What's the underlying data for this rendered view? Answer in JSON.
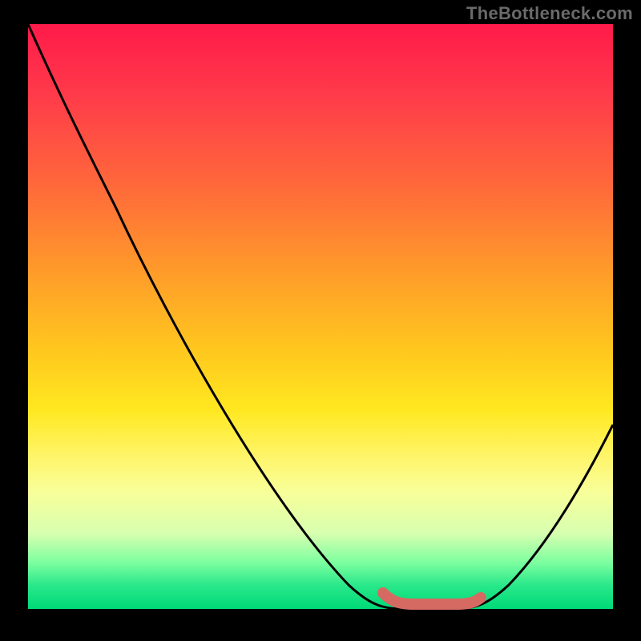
{
  "watermark": "TheBottleneck.com",
  "colors": {
    "gradient_top": "#ff1a4a",
    "gradient_bottom": "#00d978",
    "curve": "#000000",
    "marker": "#d56a63",
    "frame": "#000000",
    "watermark": "#6a6a6a"
  },
  "chart_data": {
    "type": "line",
    "title": "",
    "xlabel": "",
    "ylabel": "",
    "xlim": [
      0,
      100
    ],
    "ylim": [
      0,
      100
    ],
    "series": [
      {
        "name": "bottleneck-curve",
        "x": [
          0,
          5,
          10,
          15,
          20,
          25,
          30,
          35,
          40,
          45,
          50,
          55,
          58,
          62,
          66,
          70,
          74,
          78,
          82,
          86,
          90,
          94,
          98,
          100
        ],
        "values": [
          100,
          92,
          84,
          76,
          67,
          58,
          49,
          40,
          31,
          23,
          15,
          8,
          4,
          1,
          0,
          0,
          0,
          2,
          5,
          10,
          16,
          23,
          30,
          33
        ]
      }
    ],
    "annotations": [
      {
        "name": "optimal-range-marker",
        "x_start": 61,
        "x_end": 77,
        "y": 0,
        "color": "#d56a63"
      }
    ],
    "background": {
      "type": "vertical-gradient",
      "stops": [
        {
          "pos": 0.0,
          "color": "#ff1a4a"
        },
        {
          "pos": 0.28,
          "color": "#ff6a3a"
        },
        {
          "pos": 0.56,
          "color": "#ffc81e"
        },
        {
          "pos": 0.8,
          "color": "#f8ff9a"
        },
        {
          "pos": 1.0,
          "color": "#00d978"
        }
      ]
    },
    "grid": false,
    "legend": false
  }
}
